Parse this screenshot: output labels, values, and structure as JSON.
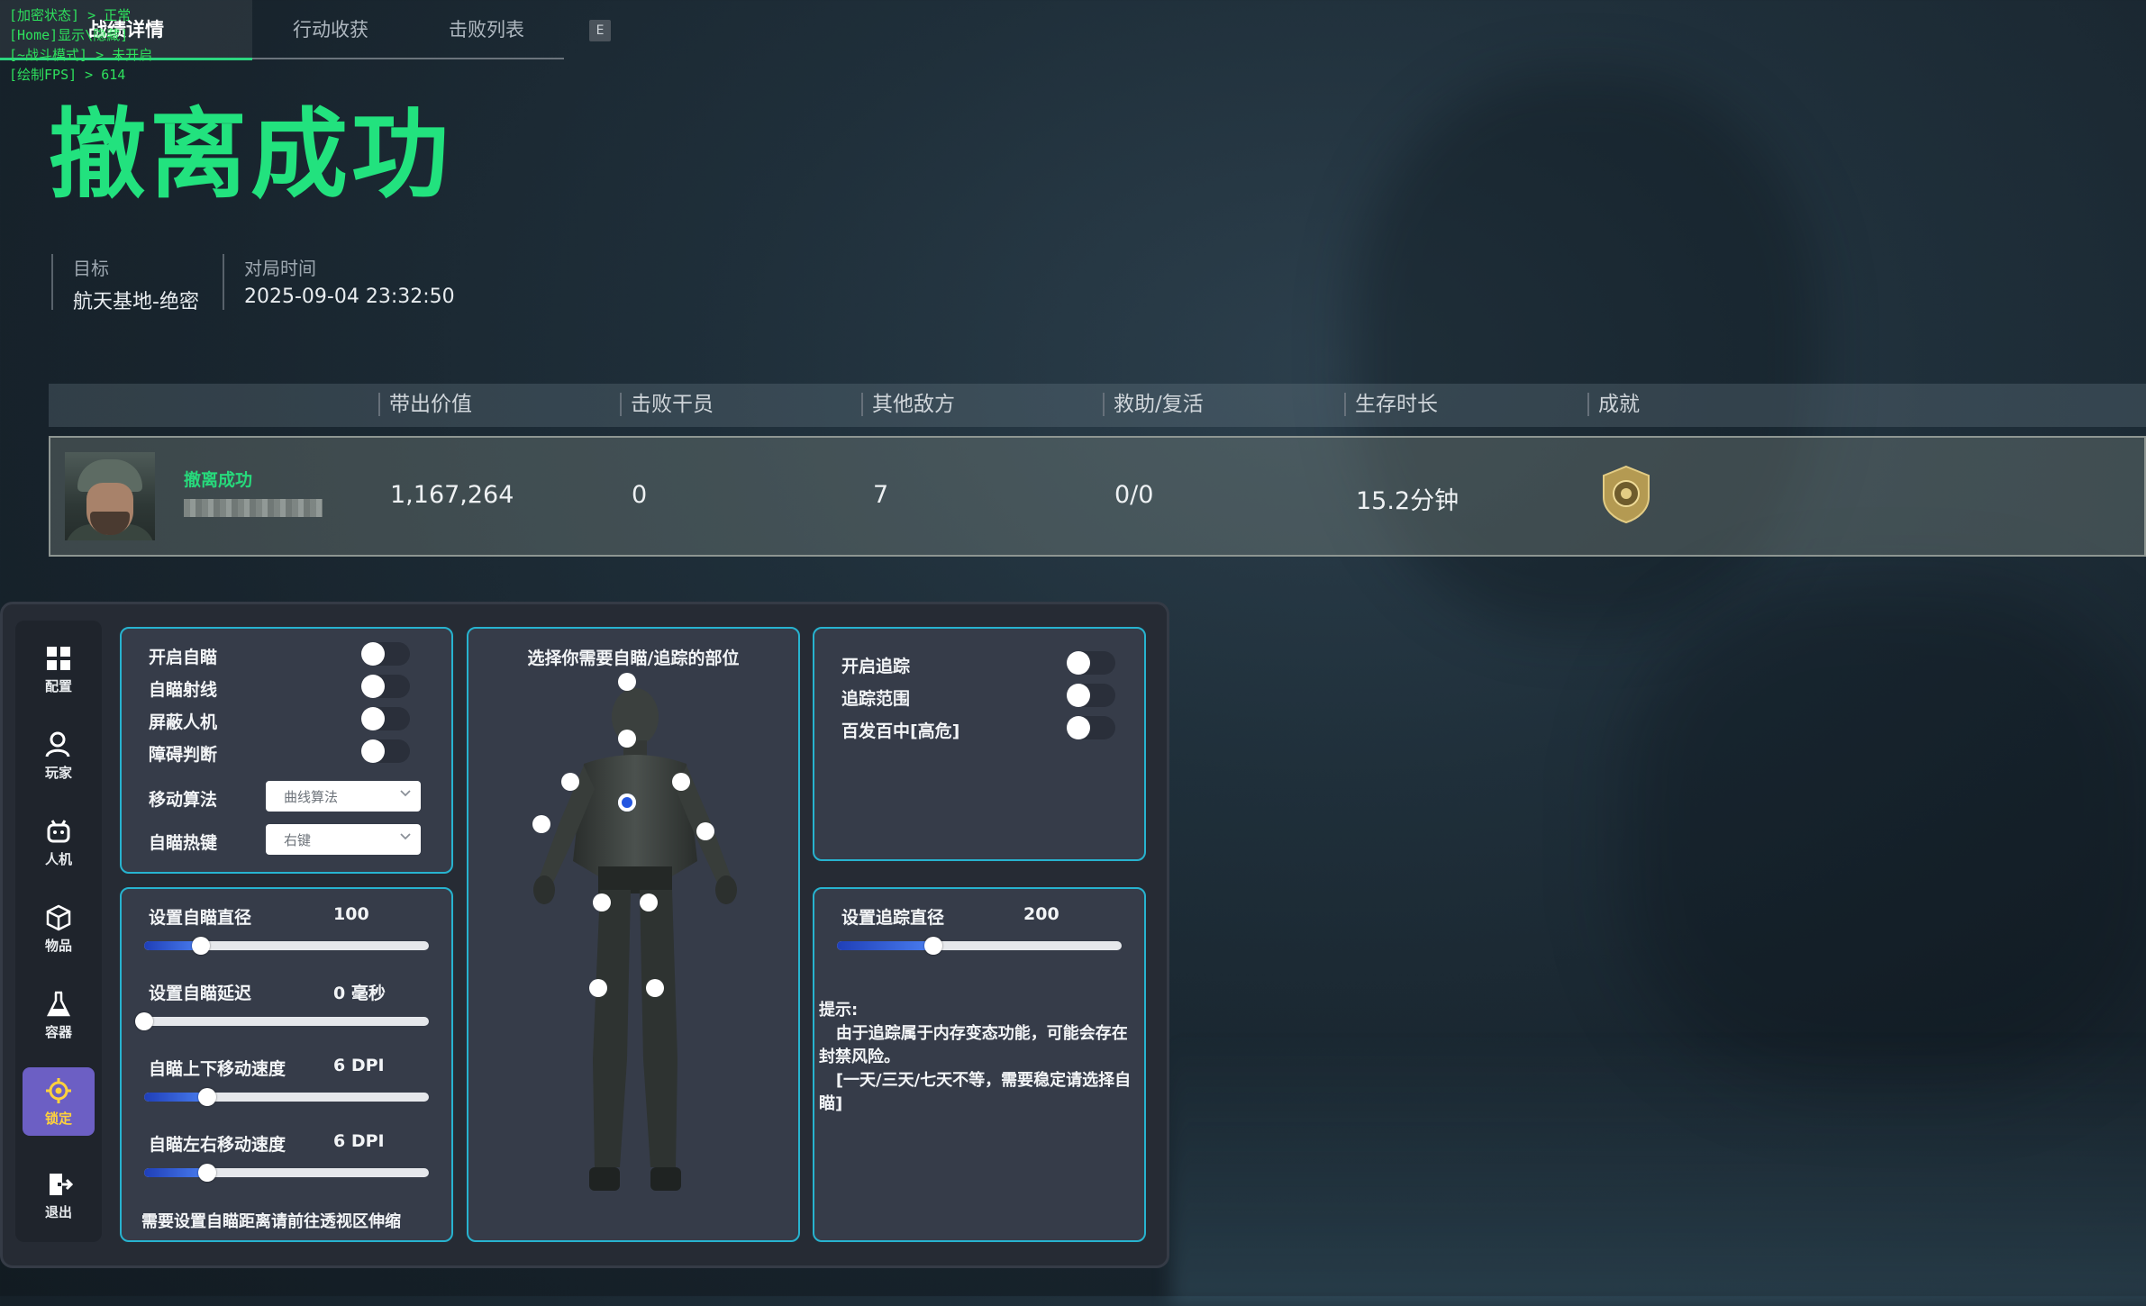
{
  "debug": {
    "line1": "[加密状态] > 正常",
    "line2": "[Home]显示\\隐藏]",
    "line3": "[~战斗模式] > 未开启",
    "line4": "[绘制FPS] > 614"
  },
  "tabs": [
    "战绩详情",
    "行动收获",
    "击败列表"
  ],
  "tab_key": "E",
  "title": "撤离成功",
  "meta": {
    "target_label": "目标",
    "target_value": "航天基地-绝密",
    "time_label": "对局时间",
    "time_value": "2025-09-04 23:32:50"
  },
  "stats": {
    "headers": [
      "带出价值",
      "击败干员",
      "其他敌方",
      "救助/复活",
      "生存时长",
      "成就"
    ],
    "row": {
      "status": "撤离成功",
      "value": "1,167,264",
      "kills": "0",
      "other_enemies": "7",
      "assist": "0/0",
      "survival": "15.2分钟"
    }
  },
  "sidebar": [
    "配置",
    "玩家",
    "人机",
    "物品",
    "容器",
    "锁定",
    "退出"
  ],
  "aim": {
    "toggles": [
      {
        "label": "开启自瞄",
        "on": false
      },
      {
        "label": "自瞄射线",
        "on": false
      },
      {
        "label": "屏蔽人机",
        "on": false
      },
      {
        "label": "障碍判断",
        "on": false
      }
    ],
    "move_algo_label": "移动算法",
    "move_algo_value": "曲线算法",
    "hotkey_label": "自瞄热键",
    "hotkey_value": "右键"
  },
  "aim_sliders": [
    {
      "label": "设置自瞄直径",
      "value_text": "100",
      "fraction": 0.2
    },
    {
      "label": "设置自瞄延迟",
      "value_text": "0 毫秒",
      "fraction": 0.0
    },
    {
      "label": "自瞄上下移动速度",
      "value_text": "6 DPI",
      "fraction": 0.22
    },
    {
      "label": "自瞄左右移动速度",
      "value_text": "6 DPI",
      "fraction": 0.22
    }
  ],
  "aim_note": "需要设置自瞄距离请前往透视区伸缩",
  "body_title": "选择你需要自瞄/追踪的部位",
  "track": {
    "toggles": [
      {
        "label": "开启追踪",
        "on": false
      },
      {
        "label": "追踪范围",
        "on": false
      },
      {
        "label": "百发百中[高危]",
        "on": false
      }
    ],
    "slider_label": "设置追踪直径",
    "slider_value_text": "200",
    "slider_fraction": 0.34,
    "tip": "提示:\n   由于追踪属于内存变态功能，可能会存在封禁风险。\n   [一天/三天/七天不等，需要稳定请选择自瞄]"
  },
  "colors": {
    "accent_green": "#22e27e",
    "card_border": "#27b3cf",
    "active_sidebar": "#6c5fc4"
  }
}
